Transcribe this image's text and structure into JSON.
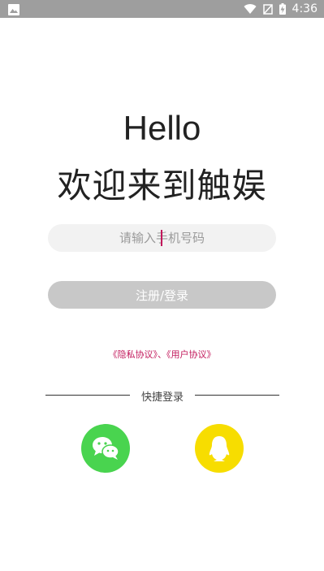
{
  "status_bar": {
    "time": "4:36",
    "icons": [
      "image-icon",
      "wifi-icon",
      "no-signal-icon",
      "battery-charging-icon"
    ]
  },
  "header": {
    "hello": "Hello",
    "welcome": "欢迎来到触娱"
  },
  "login_form": {
    "phone_placeholder": "请输入手机号码",
    "register_label": "注册/登录"
  },
  "agreements": {
    "privacy": "《隐私协议》",
    "separator": "、",
    "user": "《用户协议》"
  },
  "quick_login": {
    "label": "快捷登录",
    "providers": [
      "wechat-icon",
      "qq-icon"
    ]
  },
  "colors": {
    "accent": "#c2185b",
    "wechat": "#49d44f",
    "qq": "#f7dd00",
    "button_disabled": "#c8c8c8"
  }
}
